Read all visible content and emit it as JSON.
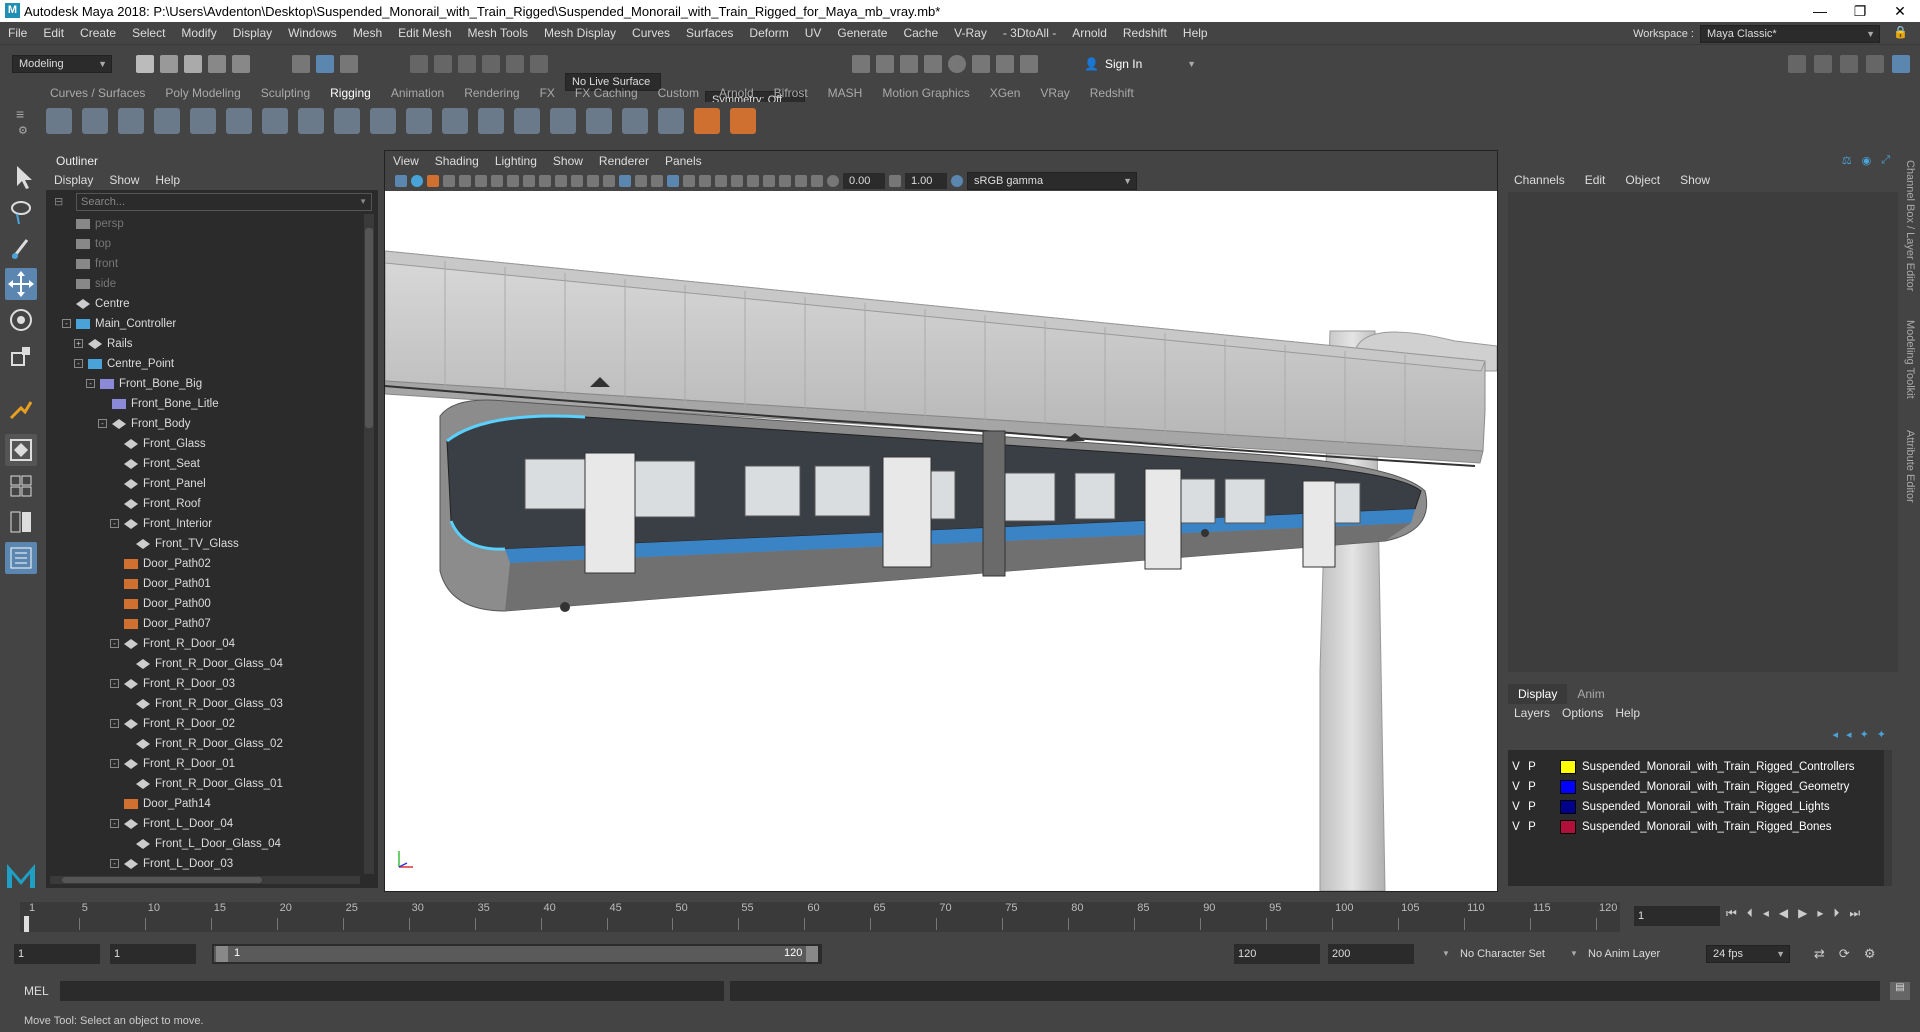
{
  "window": {
    "title": "Autodesk Maya 2018: P:\\Users\\Avdenton\\Desktop\\Suspended_Monorail_with_Train_Rigged\\Suspended_Monorail_with_Train_Rigged_for_Maya_mb_vray.mb*",
    "logo": "M"
  },
  "menu": [
    "File",
    "Edit",
    "Create",
    "Select",
    "Modify",
    "Display",
    "Windows",
    "Mesh",
    "Edit Mesh",
    "Mesh Tools",
    "Mesh Display",
    "Curves",
    "Surfaces",
    "Deform",
    "UV",
    "Generate",
    "Cache",
    "V-Ray",
    "- 3DtoAll -",
    "Arnold",
    "Redshift",
    "Help"
  ],
  "workspace": {
    "label": "Workspace :",
    "value": "Maya Classic*"
  },
  "statusline": {
    "mode": "Modeling",
    "live_surface": "No Live Surface",
    "symmetry": "Symmetry: Off",
    "sign_in": "Sign In"
  },
  "shelf_tabs": [
    "Curves / Surfaces",
    "Poly Modeling",
    "Sculpting",
    "Rigging",
    "Animation",
    "Rendering",
    "FX",
    "FX Caching",
    "Custom",
    "Arnold",
    "Bifrost",
    "MASH",
    "Motion Graphics",
    "XGen",
    "VRay",
    "Redshift"
  ],
  "shelf_active": "Rigging",
  "outliner": {
    "title": "Outliner",
    "menu": [
      "Display",
      "Show",
      "Help"
    ],
    "search_placeholder": "Search...",
    "items": [
      {
        "label": "persp",
        "depth": 0,
        "dim": true,
        "icon": "camera-icon",
        "exp": ""
      },
      {
        "label": "top",
        "depth": 0,
        "dim": true,
        "icon": "camera-icon",
        "exp": ""
      },
      {
        "label": "front",
        "depth": 0,
        "dim": true,
        "icon": "camera-icon",
        "exp": ""
      },
      {
        "label": "side",
        "depth": 0,
        "dim": true,
        "icon": "camera-icon",
        "exp": ""
      },
      {
        "label": "Centre",
        "depth": 0,
        "dim": false,
        "icon": "transform-icon",
        "exp": ""
      },
      {
        "label": "Main_Controller",
        "depth": 0,
        "dim": false,
        "icon": "curve-icon",
        "exp": "-"
      },
      {
        "label": "Rails",
        "depth": 1,
        "dim": false,
        "icon": "transform-icon",
        "exp": "+"
      },
      {
        "label": "Centre_Point",
        "depth": 1,
        "dim": false,
        "icon": "locator-icon",
        "exp": "-"
      },
      {
        "label": "Front_Bone_Big",
        "depth": 2,
        "dim": false,
        "icon": "joint-icon",
        "exp": "-"
      },
      {
        "label": "Front_Bone_Litle",
        "depth": 3,
        "dim": false,
        "icon": "joint-icon",
        "exp": ""
      },
      {
        "label": "Front_Body",
        "depth": 3,
        "dim": false,
        "icon": "transform-icon",
        "exp": "-"
      },
      {
        "label": "Front_Glass",
        "depth": 4,
        "dim": false,
        "icon": "transform-icon",
        "exp": ""
      },
      {
        "label": "Front_Seat",
        "depth": 4,
        "dim": false,
        "icon": "transform-icon",
        "exp": ""
      },
      {
        "label": "Front_Panel",
        "depth": 4,
        "dim": false,
        "icon": "transform-icon",
        "exp": ""
      },
      {
        "label": "Front_Roof",
        "depth": 4,
        "dim": false,
        "icon": "transform-icon",
        "exp": ""
      },
      {
        "label": "Front_Interior",
        "depth": 4,
        "dim": false,
        "icon": "transform-icon",
        "exp": "-"
      },
      {
        "label": "Front_TV_Glass",
        "depth": 5,
        "dim": false,
        "icon": "transform-icon",
        "exp": ""
      },
      {
        "label": "Door_Path02",
        "depth": 4,
        "dim": false,
        "icon": "path-icon",
        "exp": ""
      },
      {
        "label": "Door_Path01",
        "depth": 4,
        "dim": false,
        "icon": "path-icon",
        "exp": ""
      },
      {
        "label": "Door_Path00",
        "depth": 4,
        "dim": false,
        "icon": "path-icon",
        "exp": ""
      },
      {
        "label": "Door_Path07",
        "depth": 4,
        "dim": false,
        "icon": "path-icon",
        "exp": ""
      },
      {
        "label": "Front_R_Door_04",
        "depth": 4,
        "dim": false,
        "icon": "transform-icon",
        "exp": "-"
      },
      {
        "label": "Front_R_Door_Glass_04",
        "depth": 5,
        "dim": false,
        "icon": "transform-icon",
        "exp": ""
      },
      {
        "label": "Front_R_Door_03",
        "depth": 4,
        "dim": false,
        "icon": "transform-icon",
        "exp": "-"
      },
      {
        "label": "Front_R_Door_Glass_03",
        "depth": 5,
        "dim": false,
        "icon": "transform-icon",
        "exp": ""
      },
      {
        "label": "Front_R_Door_02",
        "depth": 4,
        "dim": false,
        "icon": "transform-icon",
        "exp": "-"
      },
      {
        "label": "Front_R_Door_Glass_02",
        "depth": 5,
        "dim": false,
        "icon": "transform-icon",
        "exp": ""
      },
      {
        "label": "Front_R_Door_01",
        "depth": 4,
        "dim": false,
        "icon": "transform-icon",
        "exp": "-"
      },
      {
        "label": "Front_R_Door_Glass_01",
        "depth": 5,
        "dim": false,
        "icon": "transform-icon",
        "exp": ""
      },
      {
        "label": "Door_Path14",
        "depth": 4,
        "dim": false,
        "icon": "path-icon",
        "exp": ""
      },
      {
        "label": "Front_L_Door_04",
        "depth": 4,
        "dim": false,
        "icon": "transform-icon",
        "exp": "-"
      },
      {
        "label": "Front_L_Door_Glass_04",
        "depth": 5,
        "dim": false,
        "icon": "transform-icon",
        "exp": ""
      },
      {
        "label": "Front_L_Door_03",
        "depth": 4,
        "dim": false,
        "icon": "transform-icon",
        "exp": "-"
      }
    ]
  },
  "viewport": {
    "menu": [
      "View",
      "Shading",
      "Lighting",
      "Show",
      "Renderer",
      "Panels"
    ],
    "exposure": "0.00",
    "gamma": "1.00",
    "color_space": "sRGB gamma"
  },
  "channel_box": {
    "menu": [
      "Channels",
      "Edit",
      "Object",
      "Show"
    ]
  },
  "side_tabs": [
    "Channel Box / Layer Editor",
    "Modeling Toolkit",
    "Attribute Editor"
  ],
  "layers": {
    "tabs": [
      "Display",
      "Anim"
    ],
    "menu": [
      "Layers",
      "Options",
      "Help"
    ],
    "items": [
      {
        "v": "V",
        "p": "P",
        "color": "#ffff00",
        "name": "Suspended_Monorail_with_Train_Rigged_Controllers"
      },
      {
        "v": "V",
        "p": "P",
        "color": "#0000ff",
        "name": "Suspended_Monorail_with_Train_Rigged_Geometry"
      },
      {
        "v": "V",
        "p": "P",
        "color": "#00008b",
        "name": "Suspended_Monorail_with_Train_Rigged_Lights"
      },
      {
        "v": "V",
        "p": "P",
        "color": "#b0103a",
        "name": "Suspended_Monorail_with_Train_Rigged_Bones"
      }
    ]
  },
  "timeline": {
    "ticks": [
      "1",
      "5",
      "10",
      "15",
      "20",
      "25",
      "30",
      "35",
      "40",
      "45",
      "50",
      "55",
      "60",
      "65",
      "70",
      "75",
      "80",
      "85",
      "90",
      "95",
      "100",
      "105",
      "110",
      "115",
      "120"
    ],
    "current_frame": "1"
  },
  "range": {
    "start": "1",
    "playback_start": "1",
    "slider_start": "1",
    "slider_end": "120",
    "playback_end": "120",
    "end": "200",
    "character_set": "No Character Set",
    "anim_layer": "No Anim Layer",
    "fps": "24 fps"
  },
  "command": {
    "label": "MEL"
  },
  "help_line": "Move Tool: Select an object to move."
}
